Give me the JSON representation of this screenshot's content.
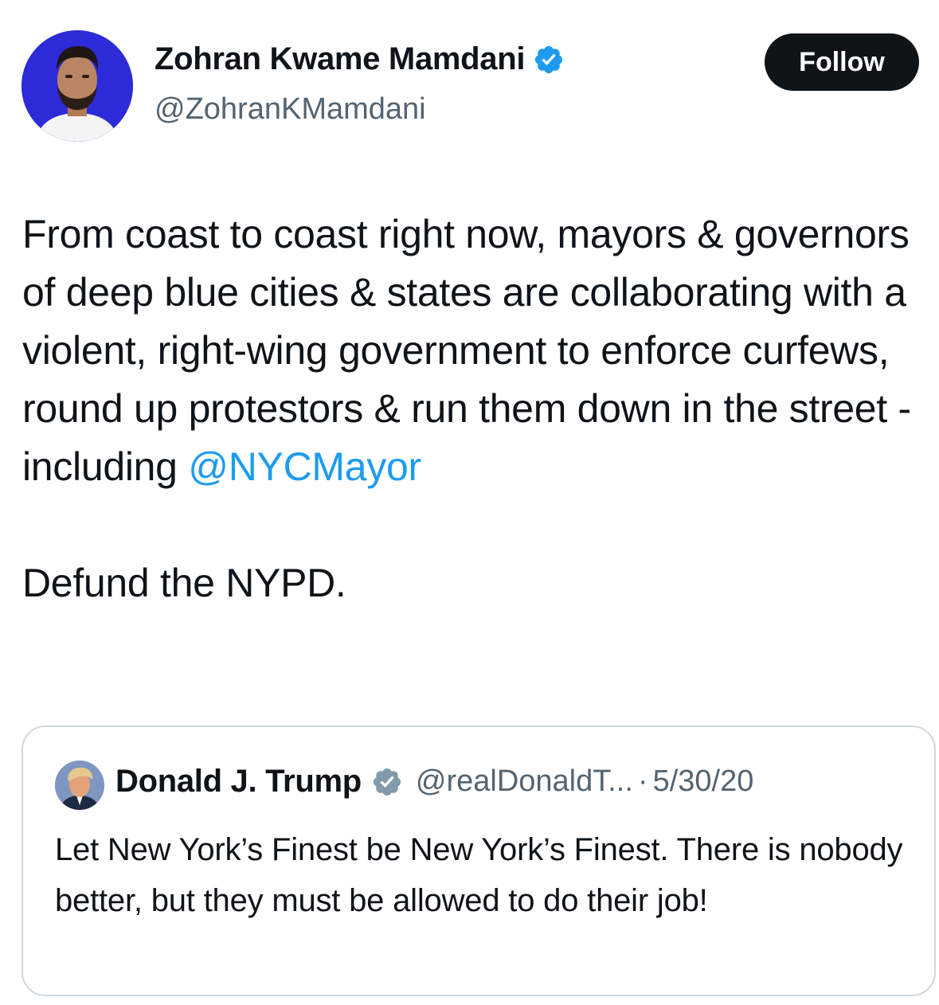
{
  "tweet": {
    "author": {
      "name": "Zohran Kwame Mamdani",
      "handle": "@ZohranKMamdani",
      "avatar_bg": "#2d2ad8",
      "verified_icon": "verified-badge-icon"
    },
    "follow_label": "Follow",
    "text_main": "From coast to coast right now, mayors & governors of deep blue cities & states are collaborating with a violent, right-wing government to enforce curfews, round up protestors & run them down in the street - including ",
    "mention": "@NYCMayor",
    "text_closing": "Defund the NYPD."
  },
  "quote": {
    "author": {
      "name": "Donald J. Trump",
      "handle": "@realDonaldT...",
      "verified_icon": "verified-badge-gray-icon"
    },
    "separator": "·",
    "date": "5/30/20",
    "text": "Let New York’s Finest be New York’s Finest. There is nobody better, but they must be allowed to do their job!"
  },
  "colors": {
    "text": "#0f1419",
    "secondary": "#536471",
    "link": "#1d9bf0",
    "verified_blue": "#1d9bf0",
    "verified_gray": "#829aab",
    "border": "#cfd9de"
  }
}
